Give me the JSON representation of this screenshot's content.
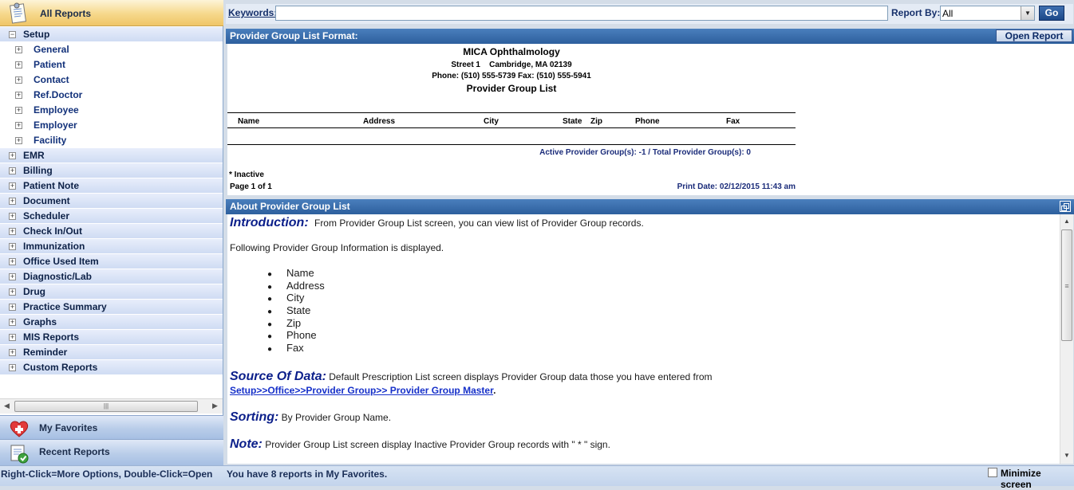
{
  "sidebar": {
    "header_label": "All Reports",
    "setup": {
      "label": "Setup",
      "children": [
        "General",
        "Patient",
        "Contact",
        "Ref.Doctor",
        "Employee",
        "Employer",
        "Facility"
      ]
    },
    "categories": [
      "EMR",
      "Billing",
      "Patient Note",
      "Document",
      "Scheduler",
      "Check In/Out",
      "Immunization",
      "Office Used Item",
      "Diagnostic/Lab",
      "Drug",
      "Practice Summary",
      "Graphs",
      "MIS Reports",
      "Reminder",
      "Custom Reports"
    ],
    "my_favorites": "My Favorites",
    "recent_reports": "Recent Reports"
  },
  "search": {
    "keywords_label": "Keywords:",
    "keywords_value": "",
    "report_by_label": "Report By:",
    "report_by_value": "All",
    "go_label": "Go"
  },
  "format_panel": {
    "title": "Provider Group List Format:",
    "open_report_label": "Open Report",
    "report": {
      "org": "MICA Ophthalmology",
      "address": "Street 1    Cambridge, MA 02139",
      "phone": "Phone: (510) 555-5739  Fax: (510) 555-5941",
      "title": "Provider Group List",
      "columns": [
        "Name",
        "Address",
        "City",
        "State",
        "Zip",
        "Phone",
        "Fax"
      ],
      "summary": "Active Provider Group(s): -1 / Total Provider Group(s): 0",
      "inactive_note": "* Inactive",
      "page": "Page 1 of 1",
      "print_date": "Print Date: 02/12/2015 11:43 am"
    }
  },
  "about_panel": {
    "title": "About Provider Group List",
    "intro_heading": "Introduction:",
    "intro_text": "From Provider Group List screen, you can view list of Provider Group records.",
    "following_text": "Following Provider Group Information is displayed.",
    "fields": [
      "Name",
      "Address",
      "City",
      "State",
      "Zip",
      "Phone",
      "Fax"
    ],
    "source_heading": "Source Of Data:",
    "source_text": "Default Prescription List screen displays Provider Group data those you have entered from",
    "source_link": "Setup>>Office>>Provider Group>> Provider Group Master",
    "sorting_heading": "Sorting:",
    "sorting_text": "By Provider Group Name.",
    "note_heading": "Note:",
    "note_text": "Provider Group List screen display Inactive Provider Group records with \" * \" sign."
  },
  "status": {
    "left_hint": "Right-Click=More Options, Double-Click=Open",
    "favorites_message": "You have 8 reports in My Favorites.",
    "minimize_label": "Minimize screen"
  },
  "colors": {
    "header_gold": "#f6d88b",
    "panel_blue": "#2d5f9d",
    "link_blue": "#1630c9",
    "heading_navy": "#0b1f8a"
  }
}
